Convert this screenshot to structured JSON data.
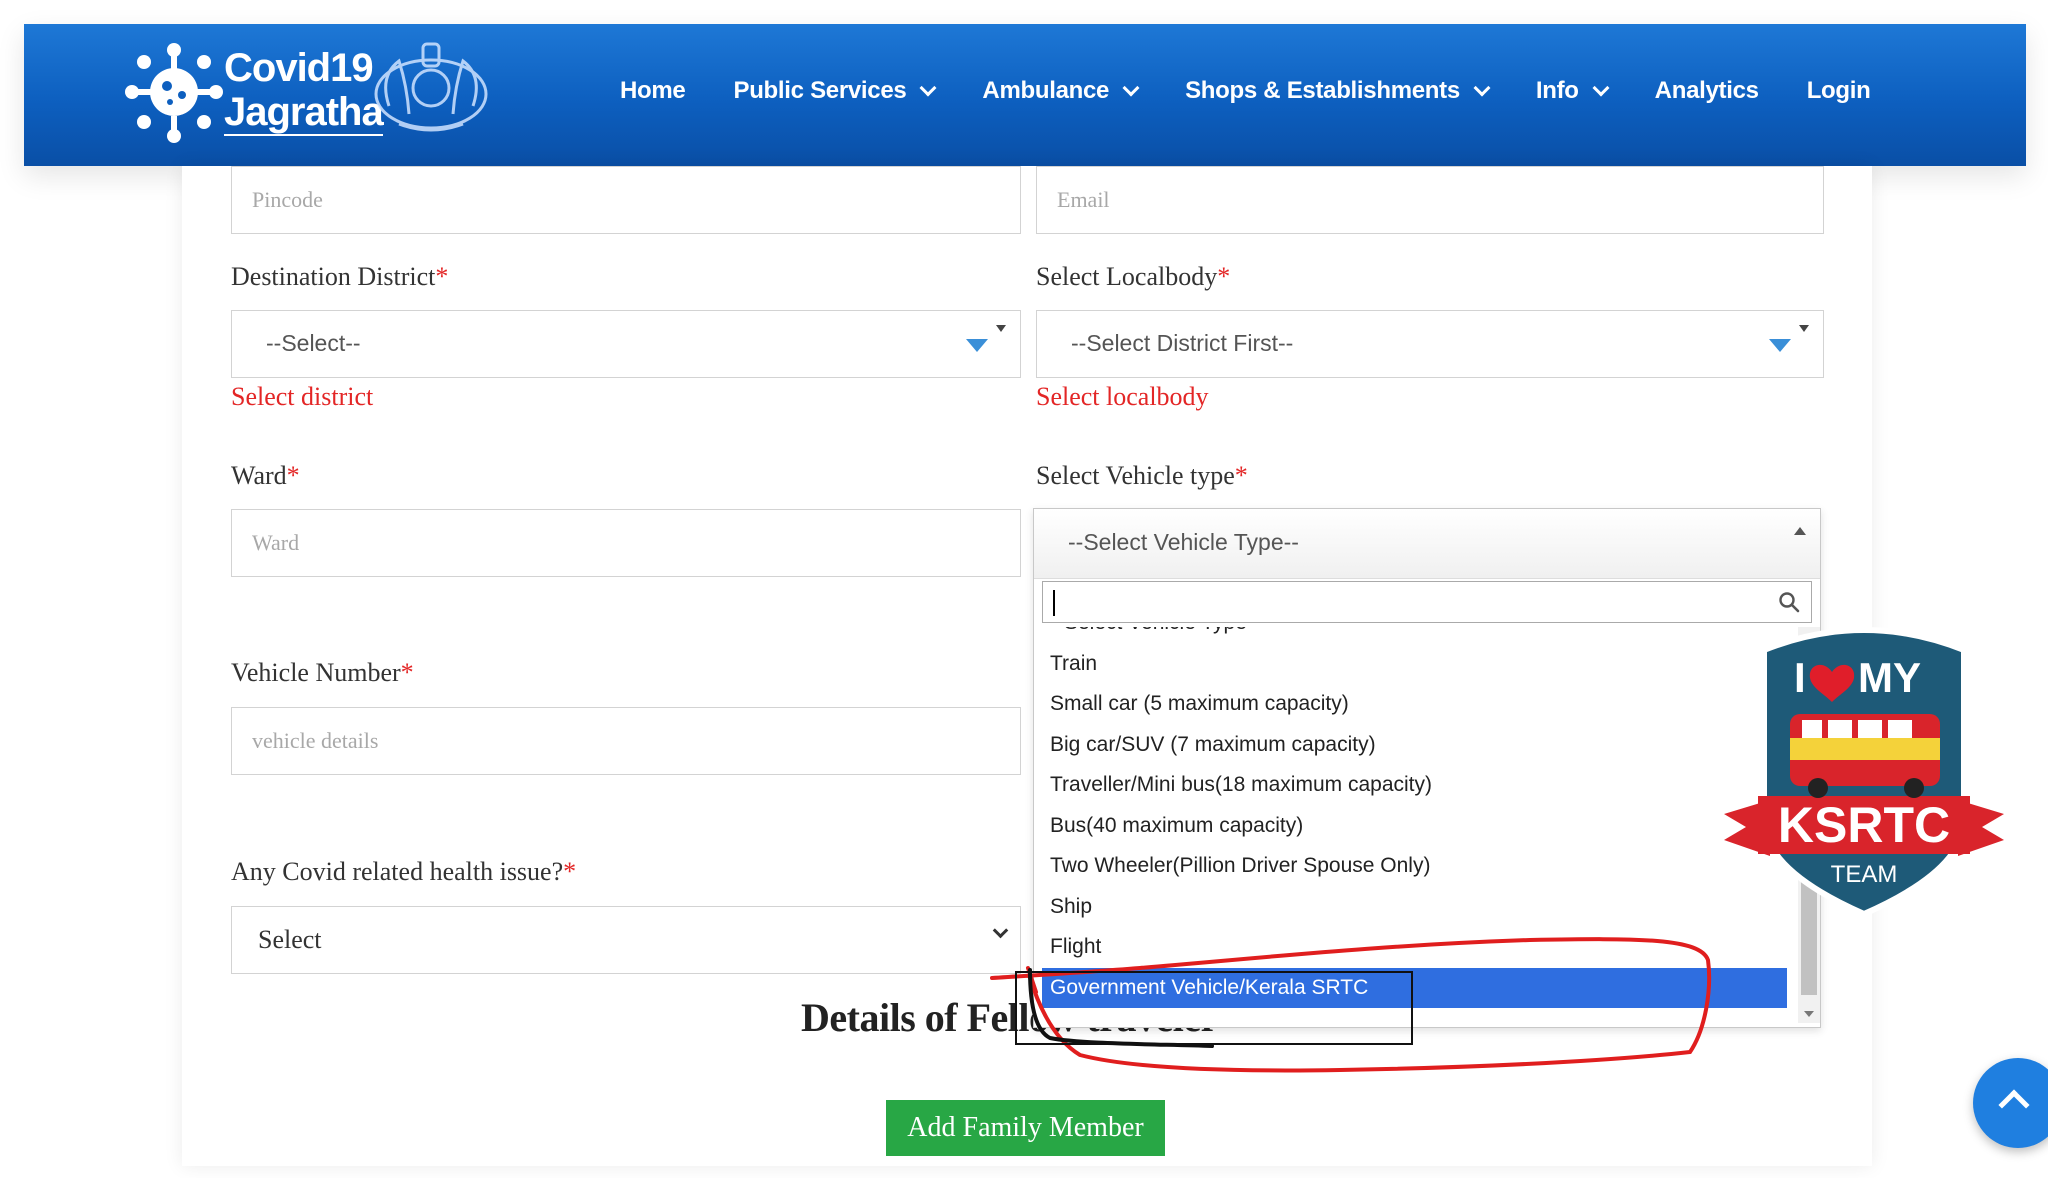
{
  "brand": {
    "line1": "Covid19",
    "line2": "Jagratha"
  },
  "nav": [
    {
      "label": "Home",
      "dropdown": false
    },
    {
      "label": "Public Services",
      "dropdown": true
    },
    {
      "label": "Ambulance",
      "dropdown": true
    },
    {
      "label": "Shops & Establishments",
      "dropdown": true
    },
    {
      "label": "Info",
      "dropdown": true
    },
    {
      "label": "Analytics",
      "dropdown": false
    },
    {
      "label": "Login",
      "dropdown": false
    }
  ],
  "form": {
    "pincode": {
      "placeholder": "Pincode"
    },
    "email": {
      "placeholder": "Email"
    },
    "destination_district": {
      "label": "Destination District",
      "required": "*",
      "value": "--Select--",
      "error": "Select district"
    },
    "localbody": {
      "label": "Select Localbody",
      "required": "*",
      "value": "--Select District First--",
      "error": "Select localbody"
    },
    "ward": {
      "label": "Ward",
      "required": "*",
      "placeholder": "Ward"
    },
    "vehicle_type": {
      "label": "Select Vehicle type",
      "required": "*",
      "value": "--Select Vehicle Type--",
      "search_value": ""
    },
    "vehicle_number": {
      "label": "Vehicle Number",
      "required": "*",
      "placeholder": "vehicle details"
    },
    "health": {
      "label": "Any Covid related health issue?",
      "required": "*",
      "value": "Select"
    }
  },
  "vehicle_options": [
    "--Select Vehicle Type--",
    "Train",
    "Small car (5 maximum capacity)",
    "Big car/SUV (7 maximum capacity)",
    "Traveller/Mini bus(18 maximum capacity)",
    "Bus(40 maximum capacity)",
    "Two Wheeler(Pillion Driver Spouse Only)",
    "Ship",
    "Flight",
    "Government Vehicle/Kerala SRTC"
  ],
  "highlighted_option_index": 9,
  "section_title": "Details of Fellow traveler",
  "add_family_button": "Add Family Member",
  "badge": {
    "top": "I",
    "my": "MY",
    "name": "KSRTC",
    "sub": "TEAM"
  },
  "colors": {
    "header": "#0d5fbf",
    "error": "#e32626",
    "highlight": "#2f6ee0",
    "button": "#28a745",
    "badge": "#1e5a78",
    "ribbon": "#d9242b"
  }
}
